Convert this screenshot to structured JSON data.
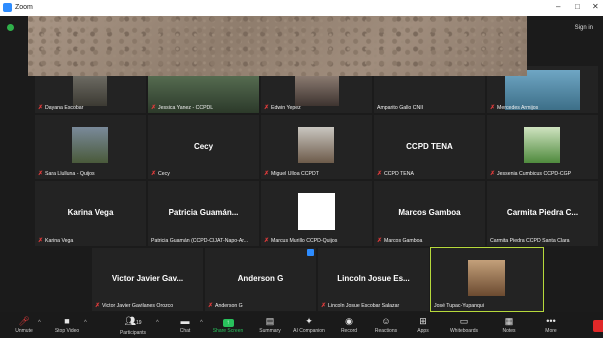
{
  "window": {
    "title": "Zoom",
    "sign_in": "Sign in"
  },
  "participants": [
    {
      "name": "Dayana Escobar",
      "muted": true
    },
    {
      "name": "Jessica Yanez - CCPDL",
      "muted": true
    },
    {
      "name": "Edwin Yepez",
      "muted": true
    },
    {
      "name": "Amparito Gallo CNII",
      "muted": false
    },
    {
      "name": "Mercedes Armijos",
      "muted": true
    },
    {
      "name": "Sara Llulluna - Quijos",
      "muted": true
    },
    {
      "name": "Cecy",
      "muted": true,
      "display": "Cecy"
    },
    {
      "name": "Miguel Ulloa CCPDT",
      "muted": true
    },
    {
      "name": "CCPD TENA",
      "muted": true,
      "display": "CCPD TENA"
    },
    {
      "name": "Jessenia Cumbicus CCPD-CGP",
      "muted": true
    },
    {
      "name": "Karina Vega",
      "muted": true,
      "display": "Karina Vega"
    },
    {
      "name": "Patricia Guamán (CCPD-CIJAT-Napo-Ar...",
      "muted": false,
      "display": "Patricia Guamán..."
    },
    {
      "name": "Marcus Murillo CCPD-Quijos",
      "muted": true
    },
    {
      "name": "Marcos Gamboa",
      "muted": true,
      "display": "Marcos Gamboa"
    },
    {
      "name": "Carmita Piedra CCPD Santa Clara",
      "muted": false,
      "display": "Carmita Piedra C..."
    },
    {
      "name": "Victor Javier Gavilanes Orozco",
      "muted": true,
      "display": "Victor Javier Gav..."
    },
    {
      "name": "Anderson G",
      "muted": true,
      "display": "Anderson G"
    },
    {
      "name": "Lincoln Josue Escobar Salazar",
      "muted": true,
      "display": "Lincoln Josue Es..."
    },
    {
      "name": "José Tupac-Yupanqui",
      "muted": false
    }
  ],
  "toolbar": {
    "unmute": "Unmute",
    "stop_video": "Stop Video",
    "participants": "Participants",
    "participants_count": "19",
    "chat": "Chat",
    "share": "Share Screen",
    "summary": "Summary",
    "companion": "AI Companion",
    "record": "Record",
    "reactions": "Reactions",
    "apps": "Apps",
    "whiteboards": "Whiteboards",
    "notes": "Notes",
    "more": "More"
  },
  "colors": {
    "active_speaker": "#b6d93b",
    "muted_icon": "#e03b3b",
    "share": "#28c25c"
  }
}
